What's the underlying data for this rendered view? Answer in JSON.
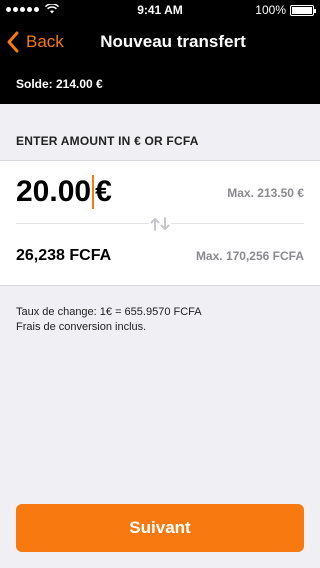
{
  "status_bar": {
    "time": "9:41 AM",
    "battery": "100%"
  },
  "nav": {
    "back_label": "Back",
    "title": "Nouveau transfert"
  },
  "balance": {
    "label": "Solde: 214.00 €"
  },
  "section": {
    "header": "ENTER AMOUNT IN € OR FCFA"
  },
  "amount": {
    "euro_value": "20.00",
    "euro_symbol": "€",
    "max_eur": "Max. 213.50 €",
    "fcfa_value": "26,238 FCFA",
    "max_fcfa": "Max. 170,256 FCFA"
  },
  "info": {
    "rate": "Taux de change: 1€ = 655.9570 FCFA",
    "fees": "Frais de conversion inclus."
  },
  "button": {
    "next_label": "Suivant"
  },
  "colors": {
    "accent": "#f7790f",
    "background": "#efeff4",
    "bar": "#000000"
  }
}
